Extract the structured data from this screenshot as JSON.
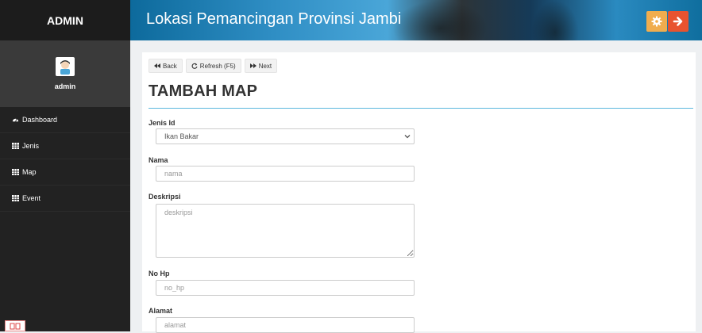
{
  "app": {
    "brand": "ADMIN",
    "header_title": "Lokasi Pemancingan Provinsi Jambi"
  },
  "sidebar": {
    "user_name": "admin",
    "items": [
      {
        "label": "Dashboard",
        "icon": "dashboard-icon"
      },
      {
        "label": "Jenis",
        "icon": "table-icon"
      },
      {
        "label": "Map",
        "icon": "table-icon"
      },
      {
        "label": "Event",
        "icon": "table-icon"
      }
    ]
  },
  "toolbar": {
    "back_label": "Back",
    "refresh_label": "Refresh (F5)",
    "next_label": "Next"
  },
  "page": {
    "title": "TAMBAH MAP"
  },
  "form": {
    "jenis_label": "Jenis Id",
    "jenis_value": "Ikan Bakar",
    "nama_label": "Nama",
    "nama_placeholder": "nama",
    "deskripsi_label": "Deskripsi",
    "deskripsi_placeholder": "deskripsi",
    "nohp_label": "No Hp",
    "nohp_placeholder": "no_hp",
    "alamat_label": "Alamat",
    "alamat_placeholder": "alamat"
  },
  "colors": {
    "sidebar_bg": "#222222",
    "gear_button": "#f0ad4e",
    "logout_button": "#e8532f",
    "title_rule": "#5bb7dd"
  }
}
